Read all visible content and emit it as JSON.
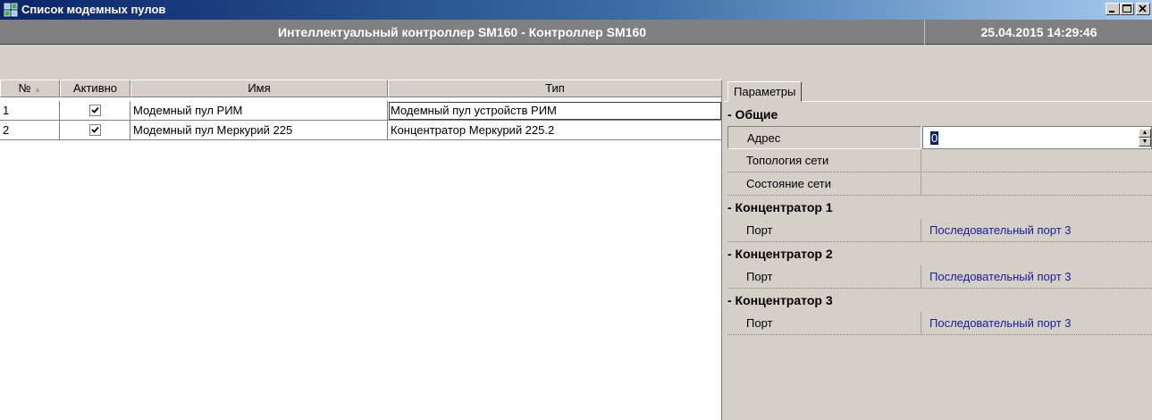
{
  "window": {
    "title": "Список модемных пулов",
    "icon": "modem-pool-app-icon"
  },
  "header": {
    "controller": "Интеллектуальный контроллер SM160 - Контроллер SM160",
    "datetime": "25.04.2015 14:29:46"
  },
  "grid": {
    "columns": [
      "№",
      "Активно",
      "Имя",
      "Тип"
    ],
    "sort_indicator": "▲",
    "rows": [
      {
        "num": "1",
        "active": true,
        "name": "Модемный пул РИМ",
        "type": "Модемный пул устройств РИМ"
      },
      {
        "num": "2",
        "active": true,
        "name": "Модемный пул Меркурий 225",
        "type": "Концентратор Меркурий 225.2"
      }
    ]
  },
  "panel": {
    "tab": "Параметры",
    "categories": [
      {
        "label": "- Общие",
        "props": [
          {
            "name": "Адрес",
            "value": "0"
          },
          {
            "name": "Топология сети",
            "value": ""
          },
          {
            "name": "Состояние сети",
            "value": ""
          }
        ]
      },
      {
        "label": "- Концентратор 1",
        "props": [
          {
            "name": "Порт",
            "value": "Последовательный порт 3"
          }
        ]
      },
      {
        "label": "- Концентратор 2",
        "props": [
          {
            "name": "Порт",
            "value": "Последовательный порт 3"
          }
        ]
      },
      {
        "label": "- Концентратор 3",
        "props": [
          {
            "name": "Порт",
            "value": "Последовательный порт 3"
          }
        ]
      }
    ]
  },
  "colors": {
    "titlebar_start": "#0a246a",
    "titlebar_end": "#a6caf0",
    "header_bg": "#808080",
    "link_value": "#1a1aa0"
  }
}
